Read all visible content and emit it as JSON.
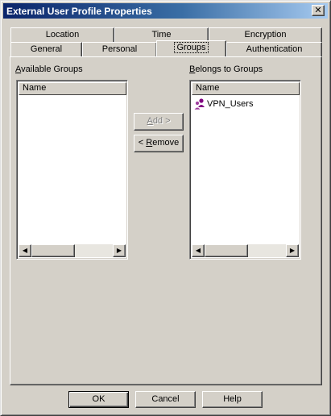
{
  "window": {
    "title": "External User Profile Properties"
  },
  "tabs": {
    "row_back": [
      "Location",
      "Time",
      "Encryption"
    ],
    "row_front": [
      "General",
      "Personal",
      "Groups",
      "Authentication"
    ],
    "selected": "Groups"
  },
  "available": {
    "label_key": "A",
    "label_rest": "vailable Groups",
    "column": "Name",
    "items": []
  },
  "belongs": {
    "label_key": "B",
    "label_rest": "elongs to Groups",
    "column": "Name",
    "items": [
      {
        "name": "VPN_Users",
        "icon": "user-group-icon"
      }
    ]
  },
  "middle_buttons": {
    "add_key": "A",
    "add_rest": "dd >",
    "remove_pre": "< ",
    "remove_key": "R",
    "remove_rest": "emove"
  },
  "footer": {
    "ok": "OK",
    "cancel": "Cancel",
    "help": "Help"
  },
  "scroll": {
    "left_arrow": "◀",
    "right_arrow": "▶"
  },
  "icons": {
    "close": "✕"
  },
  "colors": {
    "face": "#d4d0c8",
    "title_start": "#0a246a",
    "title_end": "#a6caf0",
    "group_icon": "#800080"
  }
}
